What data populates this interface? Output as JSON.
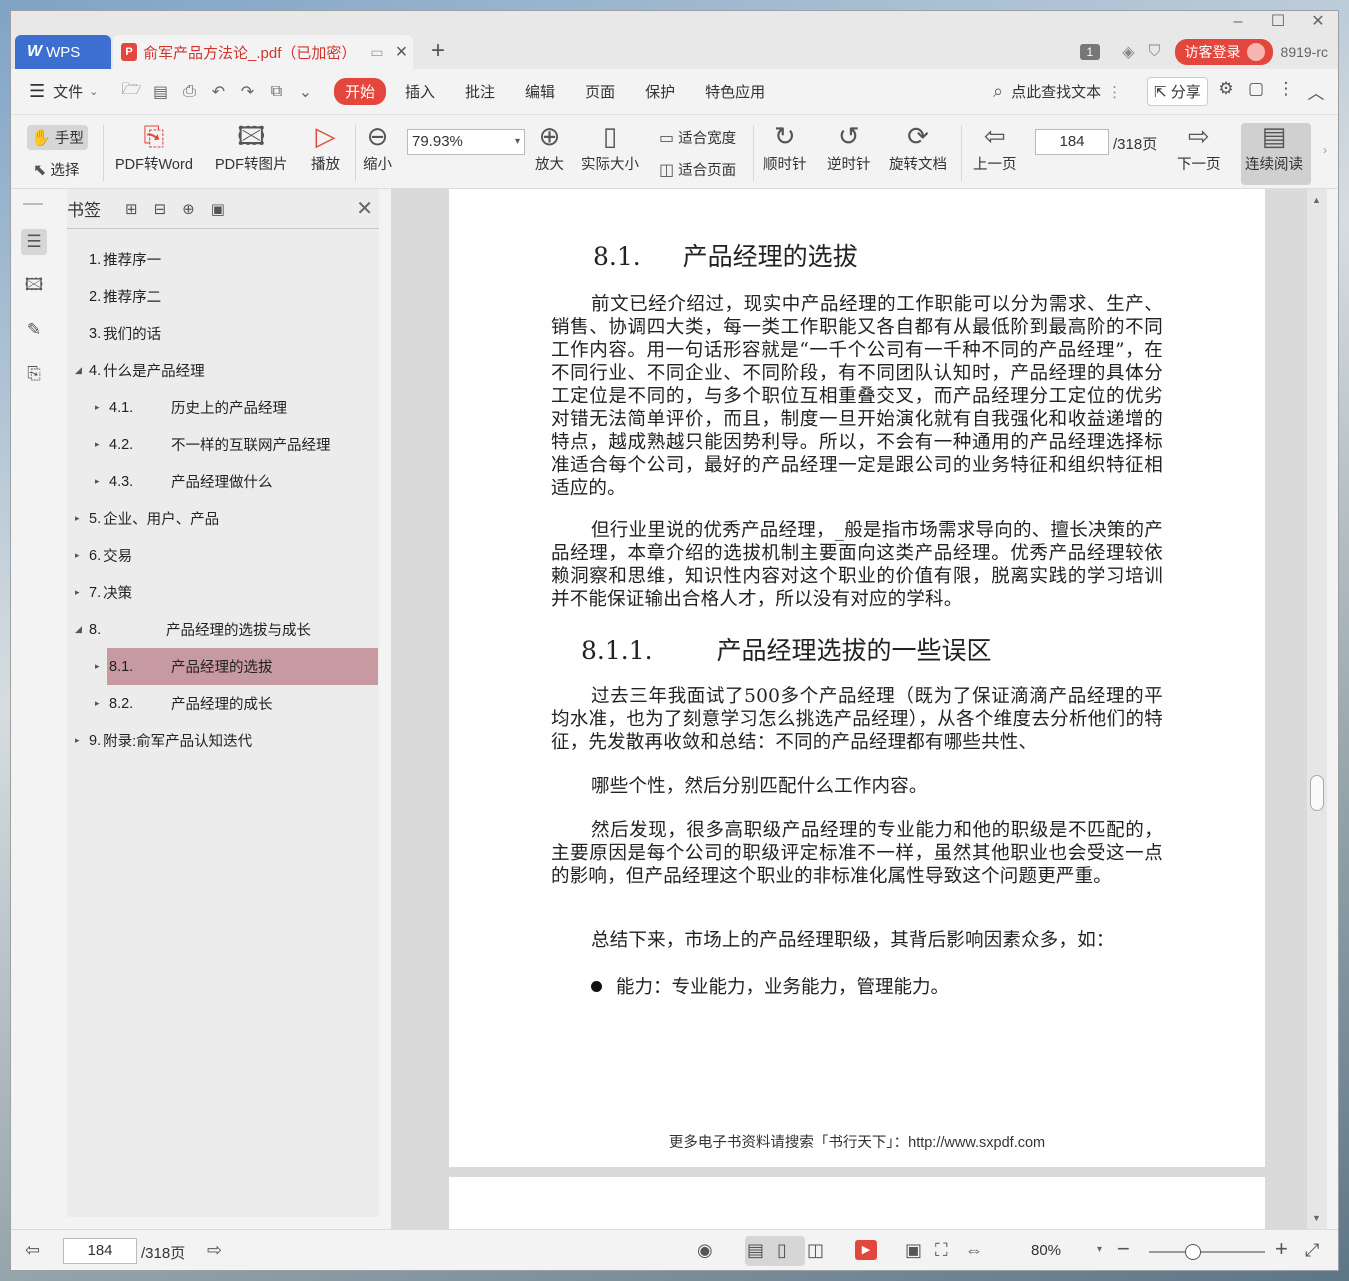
{
  "tabs": {
    "wps_label": "WPS",
    "doc_title": "俞军产品方法论_.pdf（已加密）",
    "page_badge": "1",
    "login_label": "访客登录",
    "user_code": "8919-rc"
  },
  "menu": {
    "file": "文件",
    "tabs": [
      "开始",
      "插入",
      "批注",
      "编辑",
      "页面",
      "保护",
      "特色应用"
    ],
    "search_placeholder": "点此查找文本",
    "share": "分享"
  },
  "toolbar": {
    "hand": "手型",
    "select": "选择",
    "pdf_to_word": "PDF转Word",
    "pdf_to_image": "PDF转图片",
    "play": "播放",
    "zoom_out": "缩小",
    "zoom_value": "79.93%",
    "zoom_in": "放大",
    "actual_size": "实际大小",
    "fit_width": "适合宽度",
    "fit_page": "适合页面",
    "clockwise": "顺时针",
    "counter_clockwise": "逆时针",
    "rotate_doc": "旋转文档",
    "prev_page": "上一页",
    "page_value": "184",
    "page_total": "/318页",
    "next_page": "下一页",
    "continuous_read": "连续阅读"
  },
  "bookmarks": {
    "title": "书签",
    "items": [
      {
        "num": "1.",
        "text": "推荐序一",
        "level": 0,
        "arrow": ""
      },
      {
        "num": "2.",
        "text": "推荐序二",
        "level": 0,
        "arrow": ""
      },
      {
        "num": "3.",
        "text": "我们的话",
        "level": 0,
        "arrow": ""
      },
      {
        "num": "4.",
        "text": "什么是产品经理",
        "level": 0,
        "arrow": "down"
      },
      {
        "num": "4.1.",
        "text": "历史上的产品经理",
        "level": 1,
        "arrow": "right"
      },
      {
        "num": "4.2.",
        "text": "不一样的互联网产品经理",
        "level": 1,
        "arrow": "right"
      },
      {
        "num": "4.3.",
        "text": "产品经理做什么",
        "level": 1,
        "arrow": "right"
      },
      {
        "num": "5.",
        "text": "企业、用户、产品",
        "level": 0,
        "arrow": "right"
      },
      {
        "num": "6.",
        "text": "交易",
        "level": 0,
        "arrow": "right"
      },
      {
        "num": "7.",
        "text": "决策",
        "level": 0,
        "arrow": "right"
      },
      {
        "num": "8.",
        "text": "产品经理的选拔与成长",
        "level": 0,
        "arrow": "down",
        "wide": true
      },
      {
        "num": "8.1.",
        "text": "产品经理的选拔",
        "level": 1,
        "arrow": "right",
        "selected": true
      },
      {
        "num": "8.2.",
        "text": "产品经理的成长",
        "level": 1,
        "arrow": "right"
      },
      {
        "num": "9.",
        "text": "附录:俞军产品认知迭代",
        "level": 0,
        "arrow": "right"
      }
    ]
  },
  "document": {
    "h2_num": "8.1.",
    "h2_text": "产品经理的选拔",
    "p1": "前文已经介绍过，现实中产品经理的工作职能可以分为需求、生产、销售、协调四大类，每一类工作职能又各自都有从最低阶到最高阶的不同工作内容。用一句话形容就是“一千个公司有一千种不同的产品经理”，在不同行业、不同企业、不同阶段，有不同团队认知时，产品经理的具体分工定位是不同的，与多个职位互相重叠交叉，而产品经理分工定位的优劣对错无法简单评价，而且，制度一旦开始演化就有自我强化和收益递增的特点，越成熟越只能因势利导。所以，不会有一种通用的产品经理选择标准适合每个公司，最好的产品经理一定是跟公司的业务特征和组织特征相适应的。",
    "p2": "但行业里说的优秀产品经理，_般是指市场需求导向的、擅长决策的产品经理，本章介绍的选拔机制主要面向这类产品经理。优秀产品经理较依赖洞察和思维，知识性内容对这个职业的价值有限，脱离实践的学习培训并不能保证输出合格人才，所以没有对应的学科。",
    "h3_num": "8.1.1.",
    "h3_text": "产品经理选拔的一些误区",
    "p3": "过去三年我面试了500多个产品经理（既为了保证滴滴产品经理的平均水准，也为了刻意学习怎么挑选产品经理），从各个维度去分析他们的特征，先发散再收敛和总结：不同的产品经理都有哪些共性、",
    "p4": "哪些个性，然后分别匹配什么工作内容。",
    "p5": "然后发现，很多高职级产品经理的专业能力和他的职级是不匹配的，主要原因是每个公司的职级评定标准不一样，虽然其他职业也会受这一点的影响，但产品经理这个职业的非标准化属性导致这个问题更严重。",
    "p6": "总结下来，市场上的产品经理职级，其背后影响因素众多，如：",
    "bullet1": "能力：专业能力，业务能力，管理能力。",
    "footer": "更多电子书资料请搜索「书行天下」：http://www.sxpdf.com"
  },
  "status": {
    "page_value": "184",
    "page_total": "/318页",
    "zoom": "80%"
  }
}
